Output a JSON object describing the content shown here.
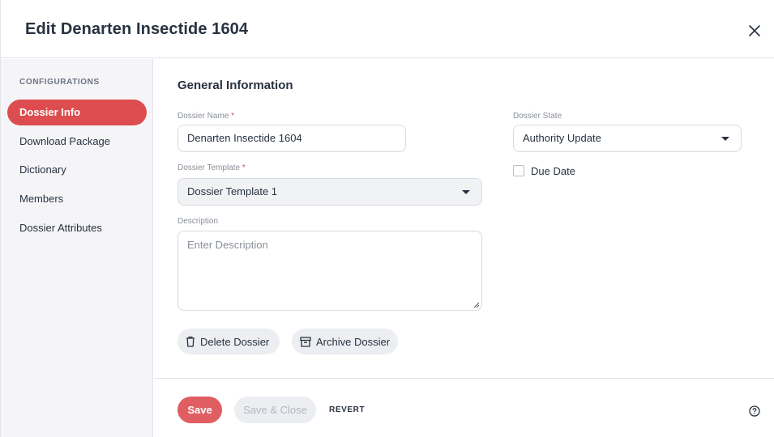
{
  "header": {
    "title": "Edit Denarten Insectide 1604",
    "close_icon": "close-icon"
  },
  "sidebar": {
    "heading": "CONFIGURATIONS",
    "items": [
      {
        "label": "Dossier Info",
        "active": true
      },
      {
        "label": "Download Package",
        "active": false
      },
      {
        "label": "Dictionary",
        "active": false
      },
      {
        "label": "Members",
        "active": false
      },
      {
        "label": "Dossier Attributes",
        "active": false
      }
    ]
  },
  "form": {
    "section_title": "General Information",
    "dossier_name": {
      "label": "Dossier Name",
      "required_mark": "*",
      "value": "Denarten Insectide 1604"
    },
    "dossier_template": {
      "label": "Dossier Template",
      "required_mark": "*",
      "value": "Dossier Template 1"
    },
    "description": {
      "label": "Description",
      "placeholder": "Enter Description",
      "value": ""
    },
    "dossier_state": {
      "label": "Dossier State",
      "value": "Authority Update"
    },
    "due_date": {
      "label": "Due Date",
      "checked": false
    },
    "delete_button": {
      "label": "Delete Dossier",
      "icon": "trash-icon"
    },
    "archive_button": {
      "label": "Archive Dossier",
      "icon": "archive-icon"
    }
  },
  "footer": {
    "save_label": "Save",
    "save_close_label": "Save & Close",
    "revert_label": "REVERT",
    "help_icon": "help-icon"
  },
  "colors": {
    "accent": "#dd4d50",
    "text": "#283241",
    "sidebar_bg": "#f5f5f7"
  }
}
